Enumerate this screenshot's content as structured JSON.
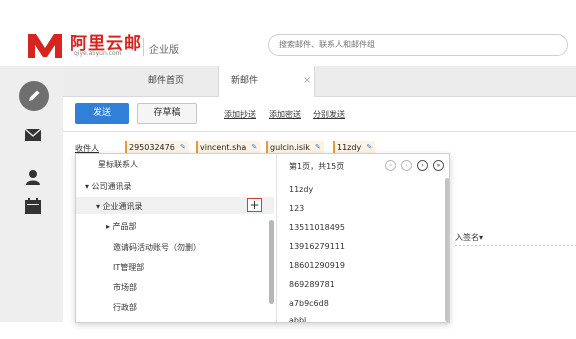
{
  "header": {
    "brand_cn": "阿里云邮",
    "brand_url": "qiye.aliyun.com",
    "edition": "企业版",
    "search_placeholder": "搜索邮件、联系人和邮件组"
  },
  "tabs": [
    {
      "label": "邮件首页"
    },
    {
      "label": "新邮件",
      "close": "×"
    }
  ],
  "toolbar": {
    "send_label": "发送",
    "draft_label": "存草稿",
    "links": [
      "添加抄送",
      "添加密送",
      "分别发送"
    ]
  },
  "recipients": {
    "label": "收件人",
    "chips": [
      "295032476",
      "vincent.sha",
      "gulcin.isik",
      "11zdy"
    ]
  },
  "tree": {
    "starred": "星标联系人",
    "company": "▾ 公司通讯录",
    "enterprise": "▾ 企业通讯录",
    "items": [
      "▸ 产品部",
      "邀请码活动账号（勿删）",
      "IT管理部",
      "市场部",
      "行政部"
    ]
  },
  "pager": {
    "text": "第1页，共15页",
    "buttons": [
      "«",
      "‹",
      "›",
      "»"
    ]
  },
  "contacts": [
    "11zdy",
    "123",
    "13511018495",
    "13916279111",
    "18601290919",
    "869289781",
    "a7b9c6d8",
    "abbl"
  ],
  "signature_label": "入签名▾",
  "colors": {
    "brand_red": "#d6251f",
    "send_blue": "#2f80d6",
    "chip_bg": "#fdf3e4",
    "add_border": "#d83a3a"
  }
}
